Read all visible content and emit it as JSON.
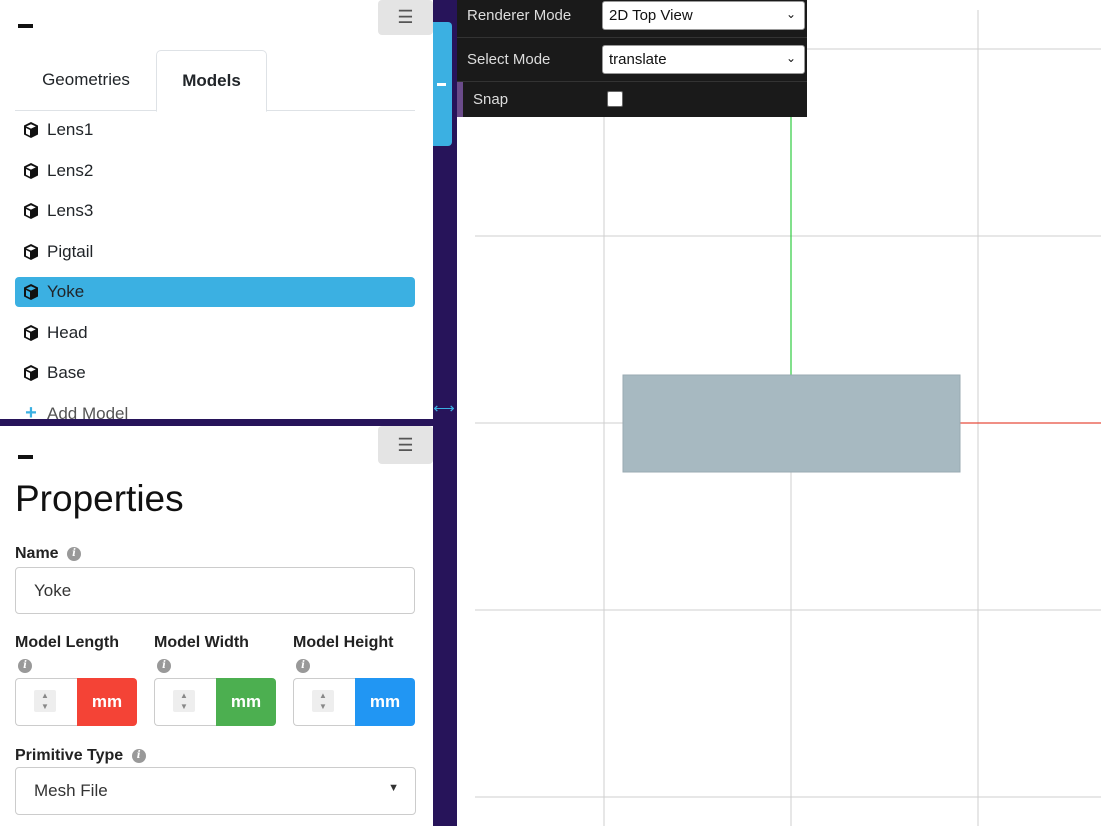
{
  "models_panel": {
    "tabs": [
      {
        "label": "Geometries",
        "active": false
      },
      {
        "label": "Models",
        "active": true
      }
    ],
    "items": [
      {
        "label": "Lens1"
      },
      {
        "label": "Lens2"
      },
      {
        "label": "Lens3"
      },
      {
        "label": "Pigtail"
      },
      {
        "label": "Yoke",
        "selected": true
      },
      {
        "label": "Head"
      },
      {
        "label": "Base"
      }
    ],
    "add_label": "Add Model"
  },
  "properties": {
    "title": "Properties",
    "name_label": "Name",
    "name_value": "Yoke",
    "length_label": "Model Length",
    "width_label": "Model Width",
    "height_label": "Model Height",
    "unit": "mm",
    "primitive_label": "Primitive Type",
    "primitive_value": "Mesh File"
  },
  "toolbar": {
    "renderer_label": "Renderer Mode",
    "renderer_value": "2D Top View",
    "select_label": "Select Mode",
    "select_value": "translate",
    "snap_label": "Snap",
    "snap_checked": false
  },
  "colors": {
    "accent_blue": "#3bb0e2",
    "divider_purple": "#27145a",
    "unit_red": "#f44336",
    "unit_green": "#4caf50",
    "unit_blue": "#2196f3",
    "model_fill": "#a7b9c1",
    "axis_green": "#2ecc40",
    "axis_red": "#e74c3c"
  }
}
